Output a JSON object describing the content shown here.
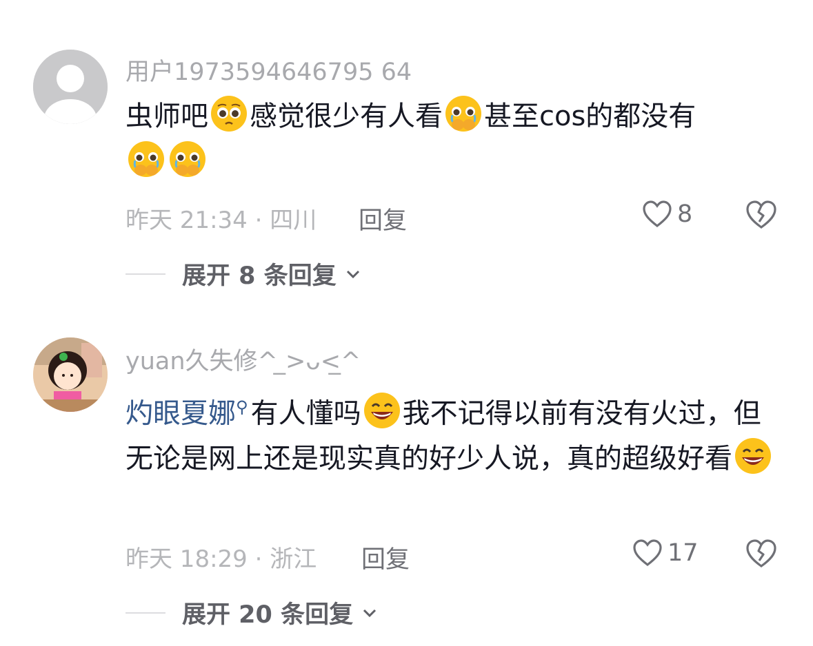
{
  "comments": [
    {
      "username": "用户1973594646795 64",
      "text_parts": [
        "虫师吧",
        "感觉很少有人看",
        "甚至cos的都没有"
      ],
      "meta": "昨天 21:34 · 四川",
      "reply_label": "回复",
      "likes": "8",
      "expand_label": "展开 8 条回复"
    },
    {
      "username": "yuan久失修^ ̲>ᴗ<̲^",
      "mention": "灼眼夏娜",
      "text_parts": [
        "有人懂吗",
        "我不记得以前有没有火过，但无论是网上还是现实真的好少人说，真的超级好看"
      ],
      "meta": "昨天 18:29 · 浙江",
      "reply_label": "回复",
      "likes": "17",
      "expand_label": "展开 20 条回复"
    }
  ],
  "icons": {
    "like": "heart-outline-icon",
    "dislike": "broken-heart-icon",
    "expand": "chevron-down-icon",
    "emoji_1": "pleading-face",
    "emoji_2": "crying-hands-face",
    "emoji_3": "grinning-face"
  },
  "colors": {
    "mention": "#35598c",
    "username": "#a8a9ad",
    "meta": "#b5b6b9",
    "text": "#161823"
  }
}
